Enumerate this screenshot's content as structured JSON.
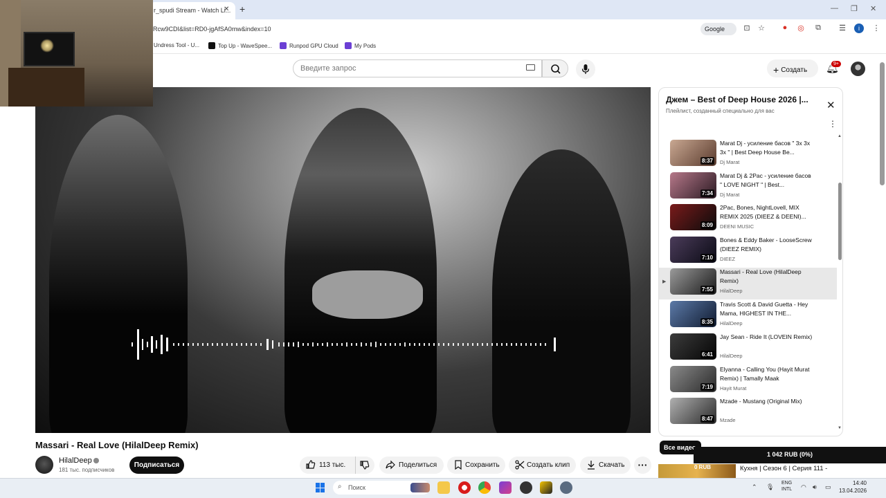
{
  "browser": {
    "tab_title": "r_spudi Stream - Watch Li...",
    "url": "Rcw9CDI&list=RD0-jgAfSA0mw&index=10",
    "google_chip": "Google",
    "bookmarks": [
      {
        "label": "Undress Tool - U...",
        "color": "#ffffff"
      },
      {
        "label": "Top Up - WaveSpee...",
        "color": "#111111"
      },
      {
        "label": "Runpod GPU Cloud",
        "color": "#6b3fd4"
      },
      {
        "label": "My Pods",
        "color": "#6b3fd4"
      }
    ]
  },
  "header": {
    "search_placeholder": "Введите запрос",
    "create_label": "Создать",
    "notif_badge": "9+"
  },
  "video": {
    "title": "Massari - Real Love (HilalDeep Remix)",
    "channel": "HilalDeep",
    "subscribers": "181 тыс. подписчиков",
    "subscribe_label": "Подписаться",
    "likes": "113 тыс.",
    "share_label": "Поделиться",
    "save_label": "Сохранить",
    "clip_label": "Создать клип",
    "download_label": "Скачать"
  },
  "playlist": {
    "title": "Джем – Best of Deep House 2026 |...",
    "subtitle": "Плейлист, созданный специально для вас",
    "items": [
      {
        "title": "Marat Dj - усиление басов \" 3х 3х 3х \" | Best Deep House Be...",
        "channel": "Dj Marat",
        "duration": "8:37"
      },
      {
        "title": "Marat Dj & 2Pac - усиление басов \" LOVE NIGHT \" | Best...",
        "channel": "Dj Marat",
        "duration": "7:34"
      },
      {
        "title": "2Pac, Bones, NightLovell, MIX REMIX 2025 (DIEEZ & DEENI)...",
        "channel": "DEENI MUSIC",
        "duration": "8:09"
      },
      {
        "title": "Bones & Eddy Baker - LooseScrew (DIEEZ REMIX)",
        "channel": "DIEEZ",
        "duration": "7:10"
      },
      {
        "title": "Massari - Real Love (HilalDeep Remix)",
        "channel": "HilalDeep",
        "duration": "7:55",
        "active": true
      },
      {
        "title": "Travis Scott & David Guetta - Hey Mama, HIGHEST IN THE...",
        "channel": "HilalDeep",
        "duration": "8:35"
      },
      {
        "title": "Jay Sean - Ride It (LOVEIN Remix)",
        "channel": "HilalDeep",
        "duration": "6:41"
      },
      {
        "title": "Elyanna - Calling You (Hayit Murat Remix) | Tamally Maak",
        "channel": "Hayit Murat",
        "duration": "7:19"
      },
      {
        "title": "Mzade - Mustang (Original Mix)",
        "channel": "Mzade",
        "duration": "8:47"
      }
    ]
  },
  "below": {
    "chip_all": "Все видео",
    "rub_banner": "1 042 RUB (0%)",
    "next_rub": "0 RUB",
    "next_title": "Кухня | Сезон 6 | Серия 111 -"
  },
  "taskbar": {
    "search_placeholder": "Поиск",
    "lang": "ENG",
    "lang2": "INTL",
    "time": "14:40",
    "date": "13.04.2026"
  }
}
